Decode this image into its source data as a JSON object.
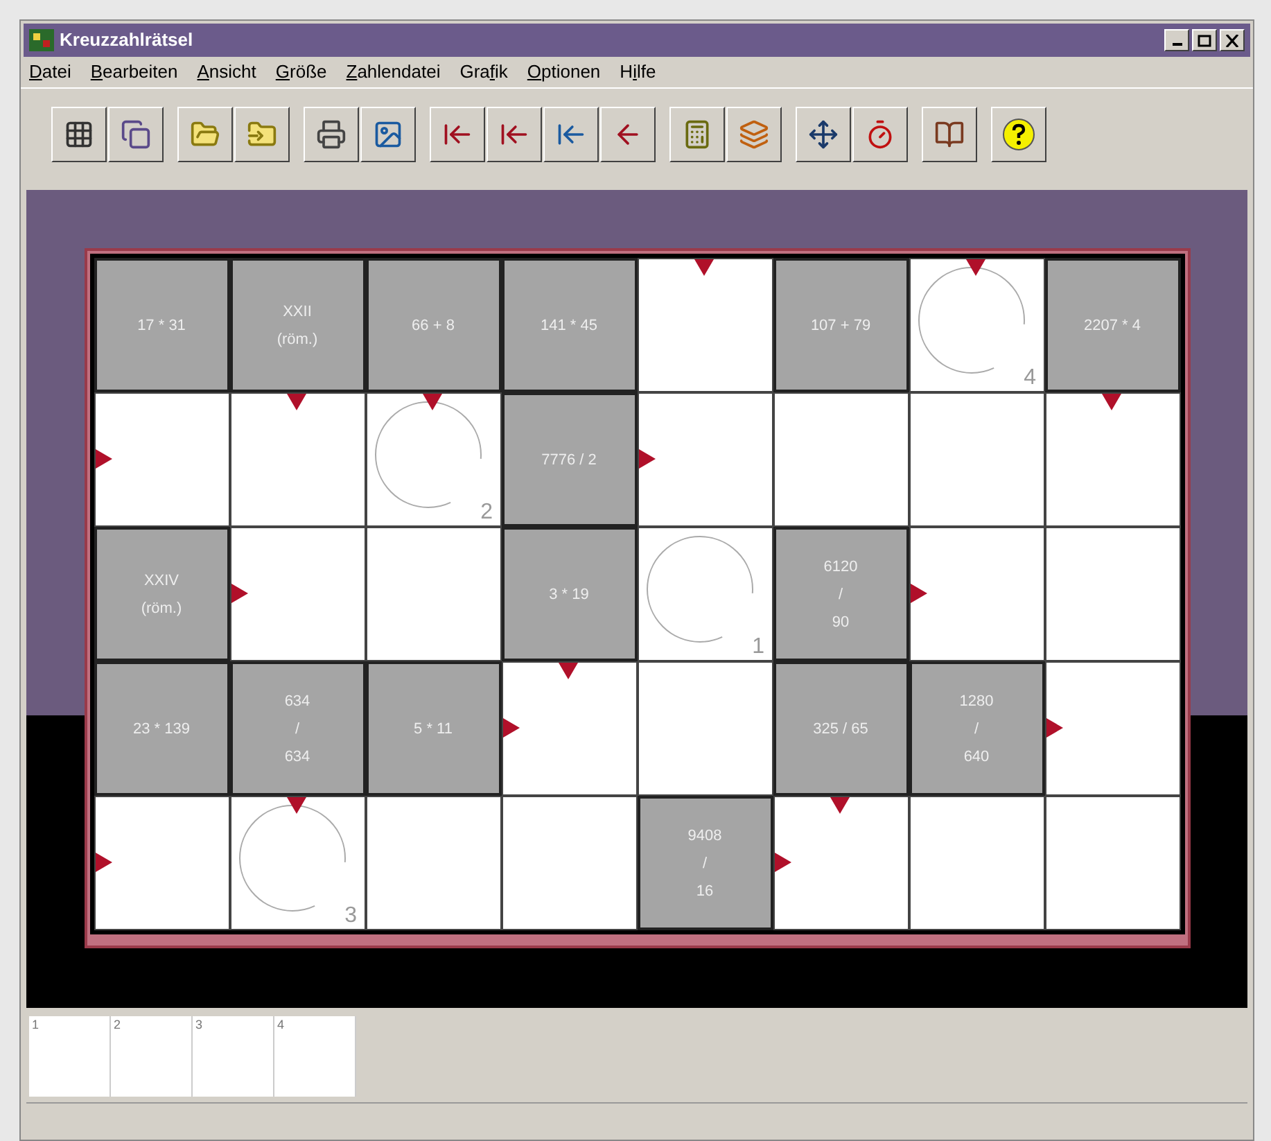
{
  "window": {
    "title": "Kreuzzahlrätsel"
  },
  "menu": [
    {
      "key": "D",
      "rest": "atei"
    },
    {
      "key": "B",
      "rest": "earbeiten"
    },
    {
      "key": "A",
      "rest": "nsicht"
    },
    {
      "key": "G",
      "rest": "röße"
    },
    {
      "key": "Z",
      "rest": "ahlendatei"
    },
    {
      "lead": "Gra",
      "key": "f",
      "rest": "ik"
    },
    {
      "key": "O",
      "rest": "ptionen"
    },
    {
      "lead": "H",
      "key": "i",
      "rest": "lfe"
    }
  ],
  "grid": [
    [
      {
        "kind": "clue",
        "lines": [
          "17 * 31"
        ]
      },
      {
        "kind": "clue",
        "lines": [
          "XXII",
          "(röm.)"
        ]
      },
      {
        "kind": "clue",
        "lines": [
          "66 + 8"
        ]
      },
      {
        "kind": "clue",
        "lines": [
          "141 * 45"
        ]
      },
      {
        "kind": "blank",
        "arrow_down": true,
        "arrow_right": false
      },
      {
        "kind": "clue",
        "lines": [
          "107 + 79"
        ]
      },
      {
        "kind": "blank",
        "arrow_down": true,
        "arrow_right": false,
        "circle": "4"
      },
      {
        "kind": "clue",
        "lines": [
          "2207 * 4"
        ]
      }
    ],
    [
      {
        "kind": "blank",
        "arrow_down": false,
        "arrow_right": true
      },
      {
        "kind": "blank",
        "arrow_down": true,
        "arrow_right": false
      },
      {
        "kind": "blank",
        "arrow_down": true,
        "arrow_right": false,
        "circle": "2"
      },
      {
        "kind": "clue",
        "lines": [
          "7776 / 2"
        ]
      },
      {
        "kind": "blank",
        "arrow_down": false,
        "arrow_right": true
      },
      {
        "kind": "blank",
        "arrow_down": false,
        "arrow_right": false
      },
      {
        "kind": "blank",
        "arrow_down": false,
        "arrow_right": false
      },
      {
        "kind": "blank",
        "arrow_down": true,
        "arrow_right": false
      }
    ],
    [
      {
        "kind": "clue",
        "lines": [
          "XXIV",
          "(röm.)"
        ]
      },
      {
        "kind": "blank",
        "arrow_down": false,
        "arrow_right": true
      },
      {
        "kind": "blank",
        "arrow_down": false,
        "arrow_right": false
      },
      {
        "kind": "clue",
        "lines": [
          "3 * 19"
        ]
      },
      {
        "kind": "blank",
        "arrow_down": false,
        "arrow_right": false,
        "circle": "1"
      },
      {
        "kind": "clue",
        "lines": [
          "6120",
          "/",
          "90"
        ]
      },
      {
        "kind": "blank",
        "arrow_down": false,
        "arrow_right": true
      },
      {
        "kind": "blank",
        "arrow_down": false,
        "arrow_right": false
      }
    ],
    [
      {
        "kind": "clue",
        "lines": [
          "23 * 139"
        ]
      },
      {
        "kind": "clue",
        "lines": [
          "634",
          "/",
          "634"
        ]
      },
      {
        "kind": "clue",
        "lines": [
          "5 * 11"
        ]
      },
      {
        "kind": "blank",
        "arrow_down": true,
        "arrow_right": true
      },
      {
        "kind": "blank",
        "arrow_down": false,
        "arrow_right": false
      },
      {
        "kind": "clue",
        "lines": [
          "325 / 65"
        ]
      },
      {
        "kind": "clue",
        "lines": [
          "1280",
          "/",
          "640"
        ]
      },
      {
        "kind": "blank",
        "arrow_down": false,
        "arrow_right": true
      }
    ],
    [
      {
        "kind": "blank",
        "arrow_down": false,
        "arrow_right": true
      },
      {
        "kind": "blank",
        "arrow_down": true,
        "arrow_right": false,
        "circle": "3"
      },
      {
        "kind": "blank",
        "arrow_down": false,
        "arrow_right": false
      },
      {
        "kind": "blank",
        "arrow_down": false,
        "arrow_right": false
      },
      {
        "kind": "clue",
        "lines": [
          "9408",
          "/",
          "16"
        ]
      },
      {
        "kind": "blank",
        "arrow_down": true,
        "arrow_right": true
      },
      {
        "kind": "blank",
        "arrow_down": false,
        "arrow_right": false
      },
      {
        "kind": "blank",
        "arrow_down": false,
        "arrow_right": false
      }
    ]
  ],
  "solution_slots": [
    {
      "label": "1"
    },
    {
      "label": "2"
    },
    {
      "label": "3"
    },
    {
      "label": "4"
    }
  ]
}
